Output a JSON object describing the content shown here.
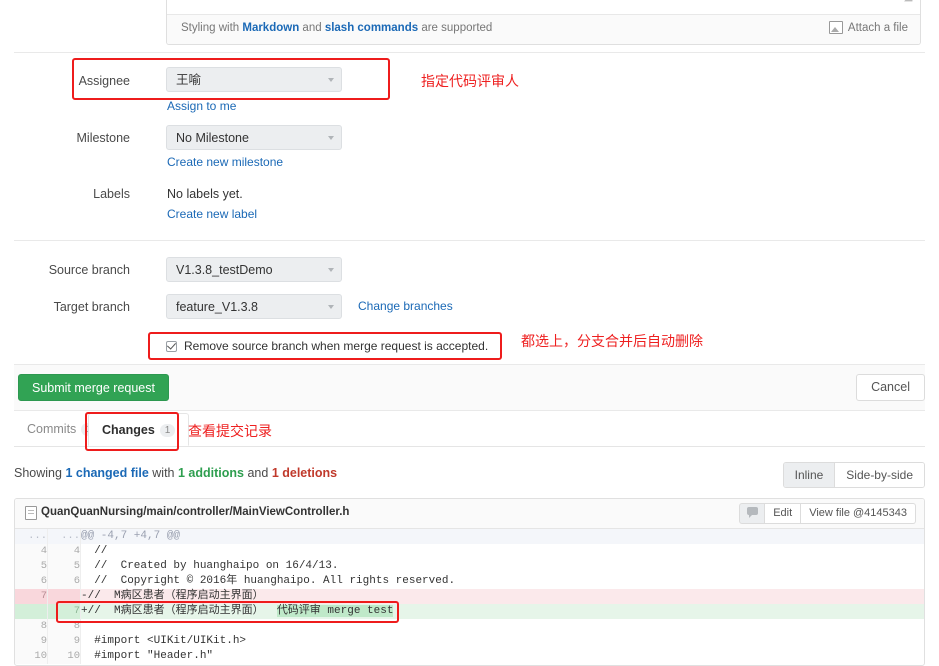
{
  "description": {
    "markdown_hint_pre": "Styling with ",
    "markdown_link": "Markdown",
    "markdown_hint_mid": " and ",
    "slash_link": "slash commands",
    "markdown_hint_post": " are supported",
    "attach_label": "Attach a file"
  },
  "form": {
    "assignee_label": "Assignee",
    "assignee_value": "王喻",
    "assign_to_me": "Assign to me",
    "milestone_label": "Milestone",
    "milestone_value": "No Milestone",
    "create_milestone": "Create new milestone",
    "labels_label": "Labels",
    "labels_value": "No labels yet.",
    "create_label": "Create new label",
    "source_branch_label": "Source branch",
    "source_branch_value": "V1.3.8_testDemo",
    "target_branch_label": "Target branch",
    "target_branch_value": "feature_V1.3.8",
    "change_branches": "Change branches",
    "remove_source_branch": "Remove source branch when merge request is accepted."
  },
  "actions": {
    "submit_label": "Submit merge request",
    "cancel_label": "Cancel"
  },
  "tabs": {
    "commits_label": "Commits",
    "commits_count": "1",
    "changes_label": "Changes",
    "changes_count": "1"
  },
  "summary": {
    "showing": "Showing",
    "changed_file": "1 changed file",
    "with": "with",
    "additions": "1 additions",
    "and": "and",
    "deletions": "1 deletions"
  },
  "view_toggle": {
    "inline": "Inline",
    "side_by_side": "Side-by-side"
  },
  "diff_file": {
    "path": "QuanQuanNursing/main/controller/MainViewController.h",
    "edit_label": "Edit",
    "view_file_label": "View file @4145343",
    "rows": [
      {
        "type": "hunk",
        "old": "...",
        "new": "...",
        "code": "@@ -4,7 +4,7 @@"
      },
      {
        "type": "ctx",
        "old": "4",
        "new": "4",
        "code": "  //"
      },
      {
        "type": "ctx",
        "old": "5",
        "new": "5",
        "code": "  //  Created by huanghaipo on 16/4/13."
      },
      {
        "type": "ctx",
        "old": "6",
        "new": "6",
        "code": "  //  Copyright © 2016年 huanghaipo. All rights reserved."
      },
      {
        "type": "del",
        "old": "7",
        "new": "",
        "code": "-//  M病区患者（程序启动主界面）"
      },
      {
        "type": "add",
        "old": "",
        "new": "7",
        "code": "+//  M病区患者（程序启动主界面）  ",
        "highlight": "代码评审 merge test"
      },
      {
        "type": "ctx",
        "old": "8",
        "new": "8",
        "code": "  "
      },
      {
        "type": "ctx",
        "old": "9",
        "new": "9",
        "code": "  #import <UIKit/UIKit.h>"
      },
      {
        "type": "ctx",
        "old": "10",
        "new": "10",
        "code": "  #import \"Header.h\""
      }
    ]
  },
  "annotations": {
    "assignee_note": "指定代码评审人",
    "remove_branch_note": "都选上，分支合并后自动删除",
    "changes_note": "查看提交记录"
  },
  "colors": {
    "annotation_red": "#ee2020",
    "link_blue": "#1b69b6",
    "submit_green": "#31a354",
    "addition_green": "#2e9e4f",
    "deletion_red": "#c0392b"
  }
}
